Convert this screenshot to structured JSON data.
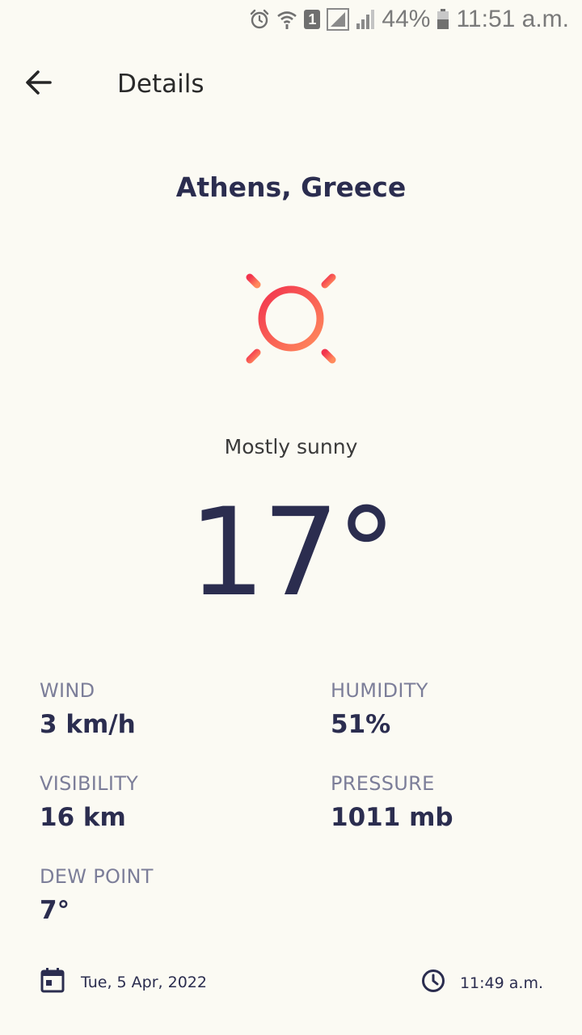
{
  "status_bar": {
    "battery_percent": "44%",
    "time": "11:51 a.m.",
    "sim_slot": "1",
    "icons": [
      "alarm-icon",
      "wifi-icon",
      "sim-icon",
      "signal-icon",
      "signal-icon",
      "battery-icon"
    ]
  },
  "appbar": {
    "title": "Details",
    "back_icon": "arrow-back-icon"
  },
  "weather": {
    "location": "Athens, Greece",
    "condition": "Mostly sunny",
    "temperature": "17°",
    "icon": "sun-icon"
  },
  "stats": {
    "wind": {
      "label": "WIND",
      "value": "3 km/h"
    },
    "humidity": {
      "label": "HUMIDITY",
      "value": "51%"
    },
    "visibility": {
      "label": "VISIBILITY",
      "value": "16 km"
    },
    "pressure": {
      "label": "PRESSURE",
      "value": "1011 mb"
    },
    "dew_point": {
      "label": "DEW POINT",
      "value": "7°"
    }
  },
  "footer": {
    "date": "Tue, 5 Apr, 2022",
    "time": "11:49 a.m.",
    "date_icon": "calendar-icon",
    "time_icon": "clock-icon"
  },
  "colors": {
    "background": "#fbfaf3",
    "primary_text": "#2b2d4f",
    "label_text": "#7c7e99",
    "sun_gradient_start": "#f2344e",
    "sun_gradient_end": "#ff8a5c"
  }
}
